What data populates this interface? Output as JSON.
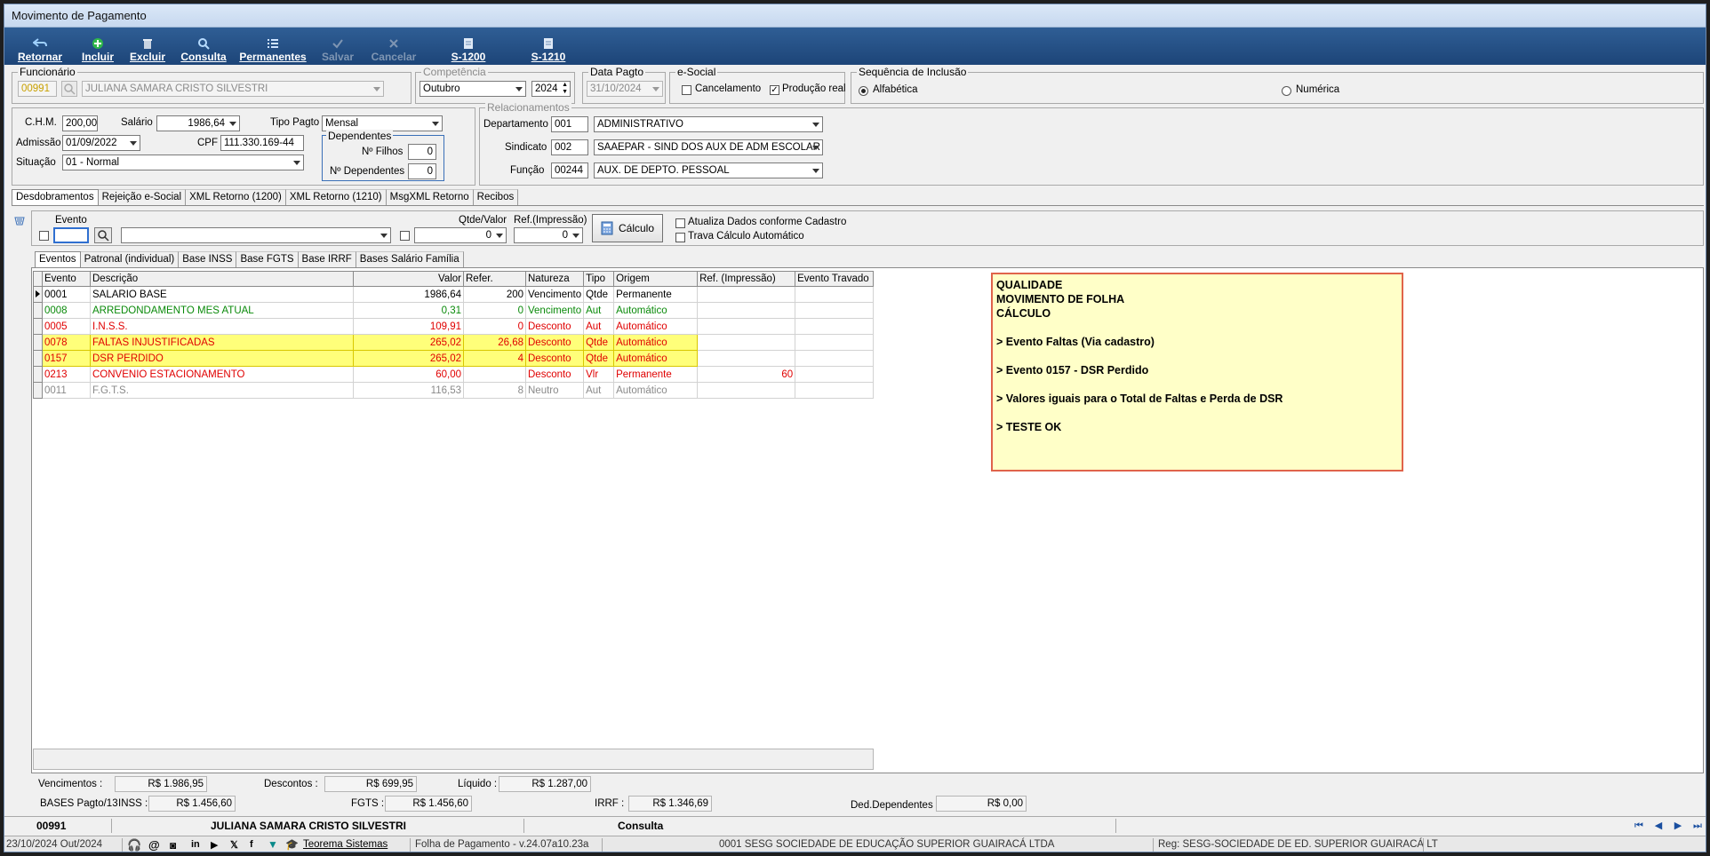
{
  "window": {
    "title": "Movimento de Pagamento"
  },
  "toolbar": {
    "retornar": "Retornar",
    "incluir": "Incluir",
    "excluir": "Excluir",
    "consulta": "Consulta",
    "permanentes": "Permanentes",
    "salvar": "Salvar",
    "cancelar": "Cancelar",
    "s1200": "S-1200",
    "s1210": "S-1210"
  },
  "funcionario": {
    "label": "Funcionário",
    "code": "00991",
    "name": "JULIANA SAMARA CRISTO SILVESTRI"
  },
  "competencia": {
    "label": "Competência",
    "month": "Outubro",
    "year": "2024"
  },
  "datapagto": {
    "label": "Data Pagto",
    "value": "31/10/2024"
  },
  "esocial": {
    "label": "e-Social",
    "cancelamento": "Cancelamento",
    "producao": "Produção real"
  },
  "sequencia": {
    "label": "Sequência de Inclusão",
    "alfabetica": "Alfabética",
    "numerica": "Numérica"
  },
  "info": {
    "chm_label": "C.H.M.",
    "chm": "200,00",
    "salario_label": "Salário",
    "salario": "1986,64",
    "tipopagto_label": "Tipo Pagto",
    "tipopagto": "Mensal",
    "admissao_label": "Admissão",
    "admissao": "01/09/2022",
    "cpf_label": "CPF",
    "cpf": "111.330.169-44",
    "situacao_label": "Situação",
    "situacao": "01 - Normal"
  },
  "dependentes": {
    "label": "Dependentes",
    "filhos_label": "Nº Filhos",
    "filhos": "0",
    "dep_label": "Nº Dependentes",
    "dep": "0"
  },
  "relacionamentos": {
    "label": "Relacionamentos",
    "depto_label": "Departamento",
    "depto_code": "001",
    "depto": "ADMINISTRATIVO",
    "sind_label": "Sindicato",
    "sind_code": "002",
    "sind": "SAAEPAR - SIND DOS AUX DE ADM ESCOLAR",
    "func_label": "Função",
    "func_code": "00244",
    "func": "AUX. DE DEPTO. PESSOAL"
  },
  "main_tabs": [
    "Desdobramentos",
    "Rejeição e-Social",
    "XML Retorno (1200)",
    "XML Retorno (1210)",
    "MsgXML Retorno",
    "Recibos"
  ],
  "evento_form": {
    "evento_label": "Evento",
    "qtde_label": "Qtde/Valor",
    "qtde": "0",
    "ref_label": "Ref.(Impressão)",
    "ref": "0",
    "calc_label": "Cálculo",
    "atualiza": "Atualiza Dados conforme Cadastro",
    "trava": "Trava Cálculo Automático"
  },
  "sub_tabs": [
    "Eventos",
    "Patronal (individual)",
    "Base INSS",
    "Base FGTS",
    "Base IRRF",
    "Bases Salário Família"
  ],
  "grid": {
    "headers": [
      "Evento",
      "Descrição",
      "Valor",
      "Refer.",
      "Natureza",
      "Tipo",
      "Origem",
      "Ref. (Impressão)",
      "Evento Travado"
    ],
    "rows": [
      {
        "evento": "0001",
        "descricao": "SALARIO BASE",
        "valor": "1986,64",
        "refer": "200",
        "natureza": "Vencimento",
        "tipo": "Qtde",
        "origem": "Permanente",
        "refimp": "",
        "travado": ""
      },
      {
        "evento": "0008",
        "descricao": "ARREDONDAMENTO MES ATUAL",
        "valor": "0,31",
        "refer": "0",
        "natureza": "Vencimento",
        "tipo": "Aut",
        "origem": "Automático",
        "refimp": "",
        "travado": ""
      },
      {
        "evento": "0005",
        "descricao": "I.N.S.S.",
        "valor": "109,91",
        "refer": "0",
        "natureza": "Desconto",
        "tipo": "Aut",
        "origem": "Automático",
        "refimp": "",
        "travado": ""
      },
      {
        "evento": "0078",
        "descricao": "FALTAS INJUSTIFICADAS",
        "valor": "265,02",
        "refer": "26,68",
        "natureza": "Desconto",
        "tipo": "Qtde",
        "origem": "Automático",
        "refimp": "",
        "travado": ""
      },
      {
        "evento": "0157",
        "descricao": "DSR PERDIDO",
        "valor": "265,02",
        "refer": "4",
        "natureza": "Desconto",
        "tipo": "Qtde",
        "origem": "Automático",
        "refimp": "",
        "travado": ""
      },
      {
        "evento": "0213",
        "descricao": "CONVENIO ESTACIONAMENTO",
        "valor": "60,00",
        "refer": "",
        "natureza": "Desconto",
        "tipo": "Vlr",
        "origem": "Permanente",
        "refimp": "60",
        "travado": ""
      },
      {
        "evento": "0011",
        "descricao": "F.G.T.S.",
        "valor": "116,53",
        "refer": "8",
        "natureza": "Neutro",
        "tipo": "Aut",
        "origem": "Automático",
        "refimp": "",
        "travado": ""
      }
    ]
  },
  "note": {
    "lines": [
      "QUALIDADE",
      "MOVIMENTO DE FOLHA",
      "CÁLCULO",
      "",
      "> Evento Faltas (Via cadastro)",
      "",
      "> Evento 0157 - DSR Perdido",
      "",
      "> Valores iguais para o Total de Faltas e Perda de DSR",
      "",
      "> TESTE OK"
    ]
  },
  "totals": {
    "venc_label": "Vencimentos :",
    "venc": "R$ 1.986,95",
    "desc_label": "Descontos :",
    "desc": "R$ 699,95",
    "liq_label": "Líquido :",
    "liq": "R$ 1.287,00",
    "bases_label": "BASES Pagto/13",
    "inss_label": "INSS :",
    "inss": "R$ 1.456,60",
    "fgts_label": "FGTS :",
    "fgts": "R$ 1.456,60",
    "irrf_label": "IRRF :",
    "irrf": "R$ 1.346,69",
    "dedep_label": "Ded.Dependentes",
    "dedep": "R$ 0,00"
  },
  "status": {
    "code": "00991",
    "name": "JULIANA SAMARA CRISTO SILVESTRI",
    "mode": "Consulta"
  },
  "bottom": {
    "date": "23/10/2024 Out/2024",
    "brand": "Teorema Sistemas",
    "version": "Folha de Pagamento - v.24.07a10.23a",
    "company": "0001 SESG SOCIEDADE DE EDUCAÇÃO SUPERIOR GUAIRACÁ LTDA",
    "reg": "Reg: SESG-SOCIEDADE DE ED. SUPERIOR GUAIRACÁ LT"
  },
  "colors": {
    "toolbar": "#1d4578",
    "note_border": "#e0634a",
    "note_bg": "#ffffc8",
    "highlight": "#ffff7a",
    "red": "#e00000",
    "green": "#0a8a0a"
  }
}
